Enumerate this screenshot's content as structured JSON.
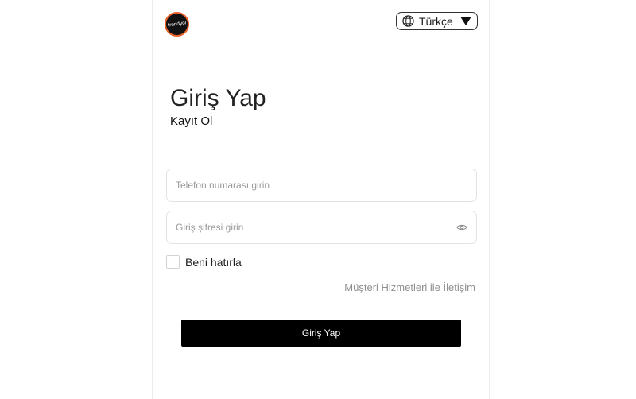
{
  "header": {
    "logo_text": "trendyol",
    "language_label": "Türkçe"
  },
  "main": {
    "title": "Giriş Yap",
    "register_link": "Kayıt Ol",
    "phone_placeholder": "Telefon numarası girin",
    "password_placeholder": "Giriş şifresi girin",
    "remember_label": "Beni hatırla",
    "support_link": "Müşteri Hizmetleri ile İletişim",
    "submit_label": "Giriş Yap"
  },
  "colors": {
    "primary_button": "#000000",
    "logo_ring": "#e8612b",
    "muted_link": "#8f8f8f"
  }
}
